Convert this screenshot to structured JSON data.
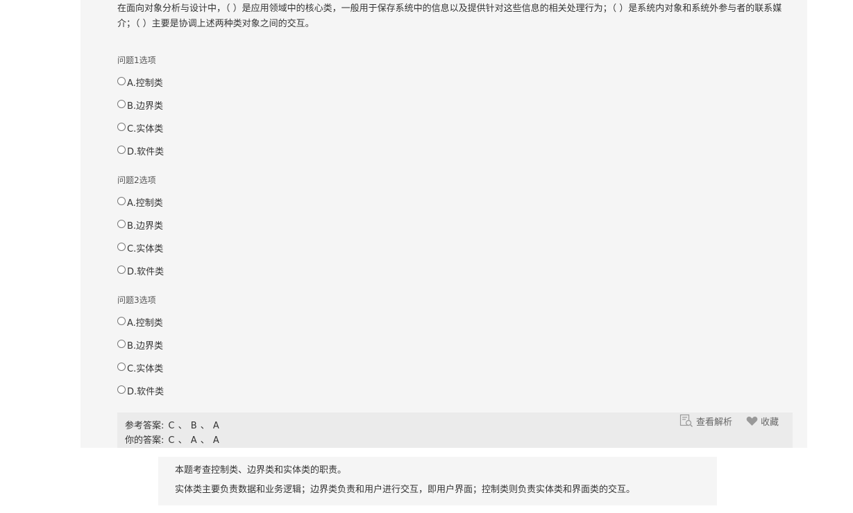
{
  "question": {
    "stem": "在面向对象分析与设计中，（ ）是应用领域中的核心类，一般用于保存系统中的信息以及提供针对这些信息的相关处理行为；（ ）是系统内对象和系统外参与者的联系媒介；（ ）主要是协调上述两种类对象之间的交互。",
    "groups": [
      {
        "title": "问题1选项",
        "options": [
          "A.控制类",
          "B.边界类",
          "C.实体类",
          "D.软件类"
        ]
      },
      {
        "title": "问题2选项",
        "options": [
          "A.控制类",
          "B.边界类",
          "C.实体类",
          "D.软件类"
        ]
      },
      {
        "title": "问题3选项",
        "options": [
          "A.控制类",
          "B.边界类",
          "C.实体类",
          "D.软件类"
        ]
      }
    ]
  },
  "answers": {
    "reference_label": "参考答案:",
    "reference_value": "C 、 B 、 A",
    "yours_label": "你的答案:",
    "yours_value": "C 、 A 、 A"
  },
  "tools": {
    "view_analysis": "查看解析",
    "favorite": "收藏",
    "view_analysis_icon": "search-document-icon",
    "favorite_icon": "heart-icon"
  },
  "analysis": {
    "line1": "本题考查控制类、边界类和实体类的职责。",
    "line2": "实体类主要负责数据和业务逻辑；边界类负责和用户进行交互，即用户界面；控制类则负责实体类和界面类的交互。"
  },
  "colors": {
    "panel_bg": "#f5f5f5",
    "answer_bg": "#ebebeb",
    "text": "#333333"
  }
}
